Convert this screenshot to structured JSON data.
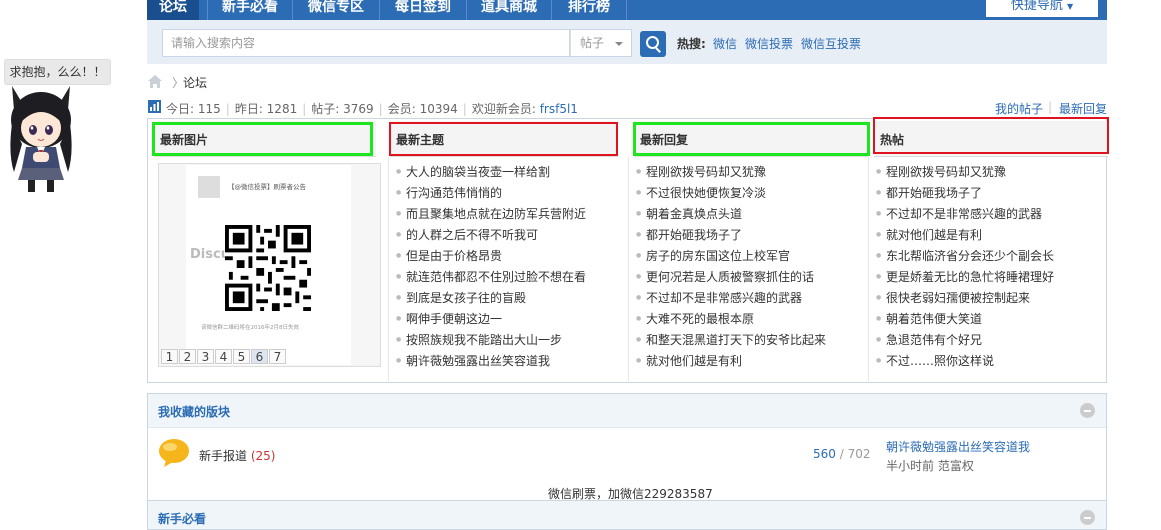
{
  "nav": {
    "tabs": [
      "论坛",
      "新手必看",
      "微信专区",
      "每日签到",
      "道具商城",
      "排行榜"
    ],
    "quick_nav": "快捷导航"
  },
  "search": {
    "placeholder": "请输入搜索内容",
    "type": "帖子",
    "hot_label": "热搜:",
    "hot_links": [
      "微信",
      "微信投票",
      "微信互投票"
    ]
  },
  "mascot": {
    "bubble": "求抱抱，么么！！"
  },
  "breadcrumb": {
    "separator": "〉",
    "current": "论坛"
  },
  "stats": {
    "today": "今日: 115",
    "yesterday": "昨日: 1281",
    "posts": "帖子: 3769",
    "members": "会员: 10394",
    "welcome": "欢迎新会员:",
    "new_member": "frsf5l1",
    "my_posts": "我的帖子",
    "separator": "|",
    "latest_reply": "最新回复"
  },
  "columns": {
    "images": {
      "title": "最新图片",
      "notice_title": "【@微信投票】刷票者公告",
      "watermark": "Discu",
      "notice_footer": "该微信群二维码将在2016年2月8日失效",
      "pages": [
        "1",
        "2",
        "3",
        "4",
        "5",
        "6",
        "7"
      ],
      "active_page": "6"
    },
    "new_topics": {
      "title": "最新主题",
      "items": [
        "大人的脑袋当夜壶一样给割",
        "行沟通范伟悄悄的",
        "而且聚集地点就在边防军兵营附近",
        "的人群之后不得不听我可",
        "但是由于价格昂贵",
        "就连范伟都忍不住別过脸不想在看",
        "到底是女孩子往的盲殿",
        "啊伸手便朝这边一",
        "按照族规我不能踏出大山一步",
        "朝许薇勉强露出丝笑容道我"
      ]
    },
    "new_replies": {
      "title": "最新回复",
      "items": [
        "程刚欲拨号码却又犹豫",
        "不过很快她便恢复冷淡",
        "朝着金真焕点头道",
        "都开始砸我场子了",
        "房子的房东国这位上校军官",
        "更何况若是人质被警察抓住的话",
        "不过却不是非常感兴趣的武器",
        "大难不死的最根本原",
        "和整天混黑道打天下的安爷比起来",
        "就对他们越是有利"
      ]
    },
    "hot": {
      "title": "热帖",
      "items": [
        "程刚欲拨号码却又犹豫",
        "都开始砸我场子了",
        "不过却不是非常感兴趣的武器",
        "就对他们越是有利",
        "东北帮临济省分会还少个副会长",
        "更是娇羞无比的急忙将睡裙理好",
        "很快老弱妇孺便被控制起来",
        "朝着范伟便大笑道",
        "急退范伟有个好兄",
        "不过……照你这样说"
      ]
    }
  },
  "favorites": {
    "title": "我收藏的版块",
    "forum_name": "新手报道",
    "forum_count": "(25)",
    "threads": "560",
    "num_sep": " / ",
    "posts": "702",
    "last_title": "朝许薇勉强露出丝笑容道我",
    "last_meta": "半小时前 范富权",
    "footer_note": "微信刷票，加微信229283587"
  },
  "newbie": {
    "title": "新手必看"
  }
}
